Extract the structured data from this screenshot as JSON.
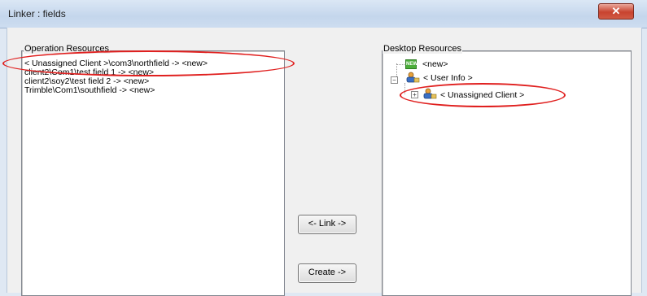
{
  "window": {
    "title": "Linker : fields",
    "close_glyph": "✕"
  },
  "operation_resources": {
    "label": "Operation Resources",
    "items": [
      "< Unassigned Client >\\com3\\northfield -> <new>",
      "client2\\Com1\\test field 1 -> <new>",
      "client2\\soy2\\test field 2 -> <new>",
      "Trimble\\Com1\\southfield -> <new>"
    ]
  },
  "desktop_resources": {
    "label": "Desktop Resources",
    "tree": {
      "new_node": "<new>",
      "user_info": "< User Info >",
      "unassigned_client": "< Unassigned Client >",
      "new_icon_text": "NEW"
    }
  },
  "buttons": {
    "link": "<- Link ->",
    "create": "Create ->"
  },
  "icons": {
    "close": "close-icon",
    "new_folder": "new-item-icon",
    "user": "user-icon",
    "expand_plus": "plus-icon",
    "collapse_minus": "minus-icon"
  },
  "colors": {
    "annotation": "#e0201f",
    "selection": "#3399ff"
  }
}
